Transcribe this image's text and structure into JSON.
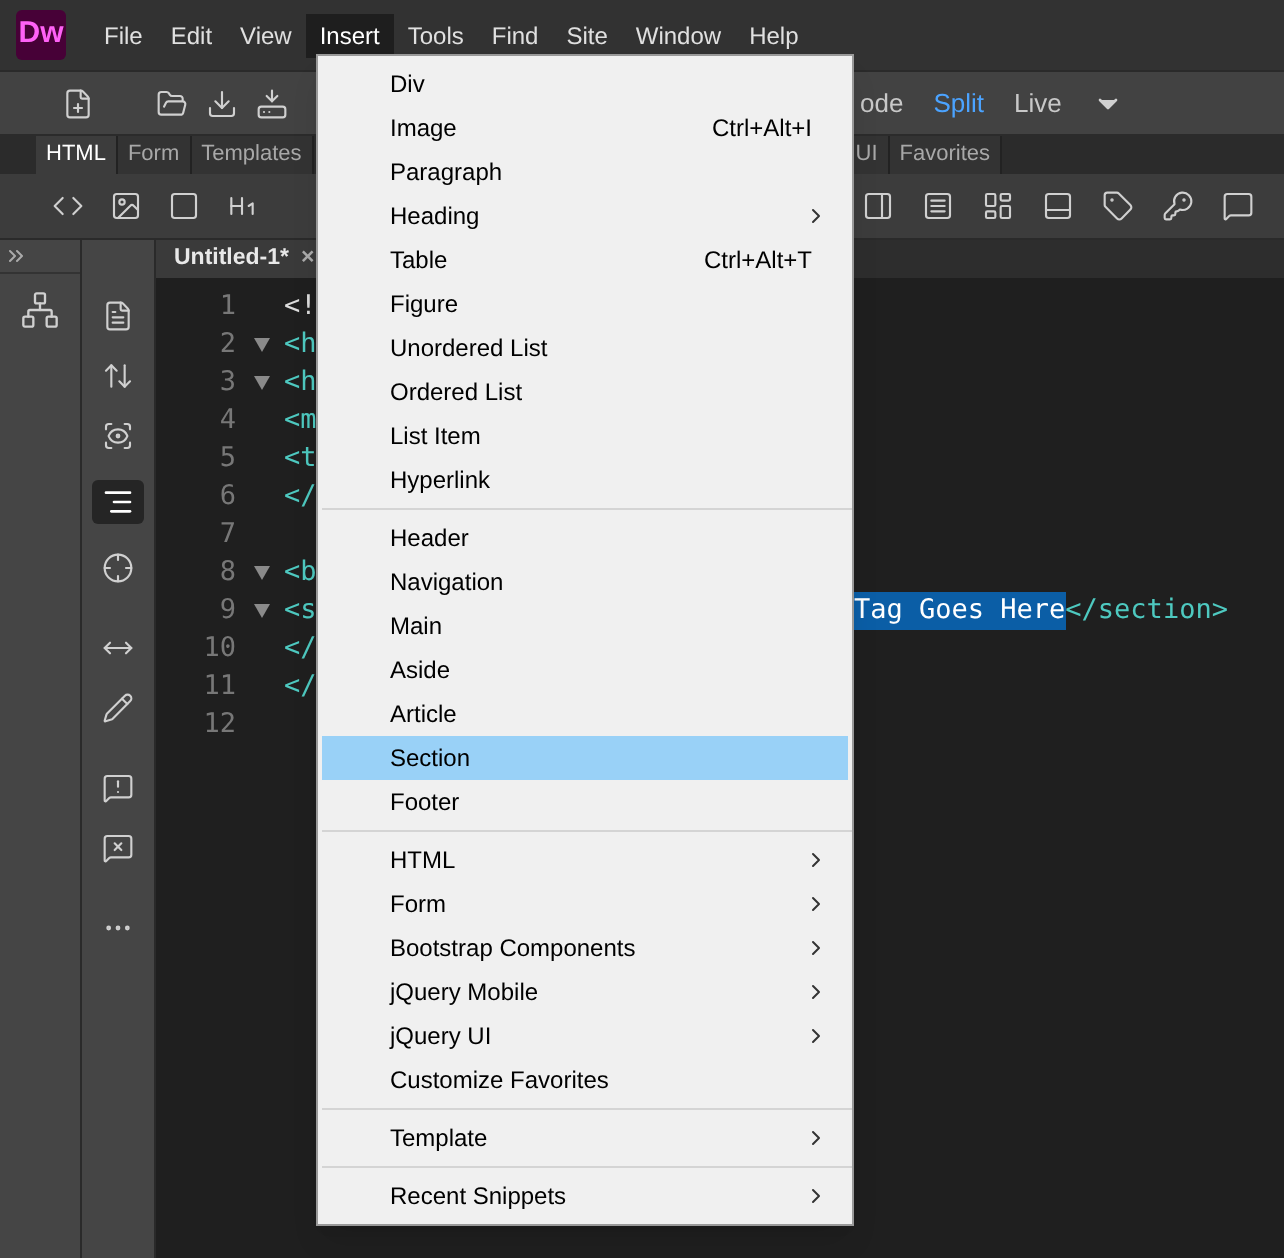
{
  "app": {
    "logo": "Dw"
  },
  "menu_bar": [
    {
      "label": "File",
      "selected": false
    },
    {
      "label": "Edit",
      "selected": false
    },
    {
      "label": "View",
      "selected": false
    },
    {
      "label": "Insert",
      "selected": true
    },
    {
      "label": "Tools",
      "selected": false
    },
    {
      "label": "Find",
      "selected": false
    },
    {
      "label": "Site",
      "selected": false
    },
    {
      "label": "Window",
      "selected": false
    },
    {
      "label": "Help",
      "selected": false
    }
  ],
  "view_modes": [
    {
      "label": "ode",
      "selected": false
    },
    {
      "label": "Split",
      "selected": true
    },
    {
      "label": "Live",
      "selected": false
    }
  ],
  "insert_tabs": [
    {
      "label": "HTML",
      "selected": true
    },
    {
      "label": "Form",
      "selected": false
    },
    {
      "label": "Templates",
      "selected": false
    },
    {
      "label": "UI",
      "selected": false
    },
    {
      "label": "Favorites",
      "selected": false
    }
  ],
  "document_tab": {
    "title": "Untitled-1*",
    "close": "×"
  },
  "code_lines": [
    {
      "number": "1",
      "foldable": false,
      "kind": "doctype",
      "text": "<!"
    },
    {
      "number": "2",
      "foldable": true,
      "kind": "tag",
      "text": "<h"
    },
    {
      "number": "3",
      "foldable": true,
      "kind": "tag",
      "text": "<h"
    },
    {
      "number": "4",
      "foldable": false,
      "kind": "tag",
      "text": "<m"
    },
    {
      "number": "5",
      "foldable": false,
      "kind": "tag",
      "text": "<t"
    },
    {
      "number": "6",
      "foldable": false,
      "kind": "tag",
      "text": "</"
    },
    {
      "number": "7",
      "foldable": false,
      "kind": "blank"
    },
    {
      "number": "8",
      "foldable": true,
      "kind": "tag",
      "text": "<b"
    },
    {
      "number": "9",
      "foldable": true,
      "kind": "tag",
      "text": "<s",
      "tail": [
        {
          "text": "Tag Goes Here",
          "selected": true
        },
        {
          "text": "</section>",
          "selected": false
        }
      ]
    },
    {
      "number": "10",
      "foldable": false,
      "kind": "tag",
      "text": "</"
    },
    {
      "number": "11",
      "foldable": false,
      "kind": "tag",
      "text": "</"
    },
    {
      "number": "12",
      "foldable": false,
      "kind": "blank"
    }
  ],
  "insert_menu": [
    {
      "kind": "item",
      "label": "Div",
      "submenu": false,
      "selected": false
    },
    {
      "kind": "item",
      "label": "Image",
      "shortcut": "Ctrl+Alt+I",
      "submenu": false,
      "selected": false
    },
    {
      "kind": "item",
      "label": "Paragraph",
      "submenu": false,
      "selected": false
    },
    {
      "kind": "item",
      "label": "Heading",
      "submenu": true,
      "selected": false
    },
    {
      "kind": "item",
      "label": "Table",
      "shortcut": "Ctrl+Alt+T",
      "submenu": false,
      "selected": false
    },
    {
      "kind": "item",
      "label": "Figure",
      "submenu": false,
      "selected": false
    },
    {
      "kind": "item",
      "label": "Unordered List",
      "submenu": false,
      "selected": false
    },
    {
      "kind": "item",
      "label": "Ordered List",
      "submenu": false,
      "selected": false
    },
    {
      "kind": "item",
      "label": "List Item",
      "submenu": false,
      "selected": false
    },
    {
      "kind": "item",
      "label": "Hyperlink",
      "submenu": false,
      "selected": false
    },
    {
      "kind": "separator"
    },
    {
      "kind": "item",
      "label": "Header",
      "submenu": false,
      "selected": false
    },
    {
      "kind": "item",
      "label": "Navigation",
      "submenu": false,
      "selected": false
    },
    {
      "kind": "item",
      "label": "Main",
      "submenu": false,
      "selected": false
    },
    {
      "kind": "item",
      "label": "Aside",
      "submenu": false,
      "selected": false
    },
    {
      "kind": "item",
      "label": "Article",
      "submenu": false,
      "selected": false
    },
    {
      "kind": "item",
      "label": "Section",
      "submenu": false,
      "selected": true
    },
    {
      "kind": "item",
      "label": "Footer",
      "submenu": false,
      "selected": false
    },
    {
      "kind": "separator"
    },
    {
      "kind": "item",
      "label": "HTML",
      "submenu": true,
      "selected": false
    },
    {
      "kind": "item",
      "label": "Form",
      "submenu": true,
      "selected": false
    },
    {
      "kind": "item",
      "label": "Bootstrap Components",
      "submenu": true,
      "selected": false
    },
    {
      "kind": "item",
      "label": "jQuery Mobile",
      "submenu": true,
      "selected": false
    },
    {
      "kind": "item",
      "label": "jQuery UI",
      "submenu": true,
      "selected": false
    },
    {
      "kind": "item",
      "label": "Customize Favorites",
      "submenu": false,
      "selected": false
    },
    {
      "kind": "separator"
    },
    {
      "kind": "item",
      "label": "Template",
      "submenu": true,
      "selected": false
    },
    {
      "kind": "separator"
    },
    {
      "kind": "item",
      "label": "Recent Snippets",
      "submenu": true,
      "selected": false
    }
  ]
}
